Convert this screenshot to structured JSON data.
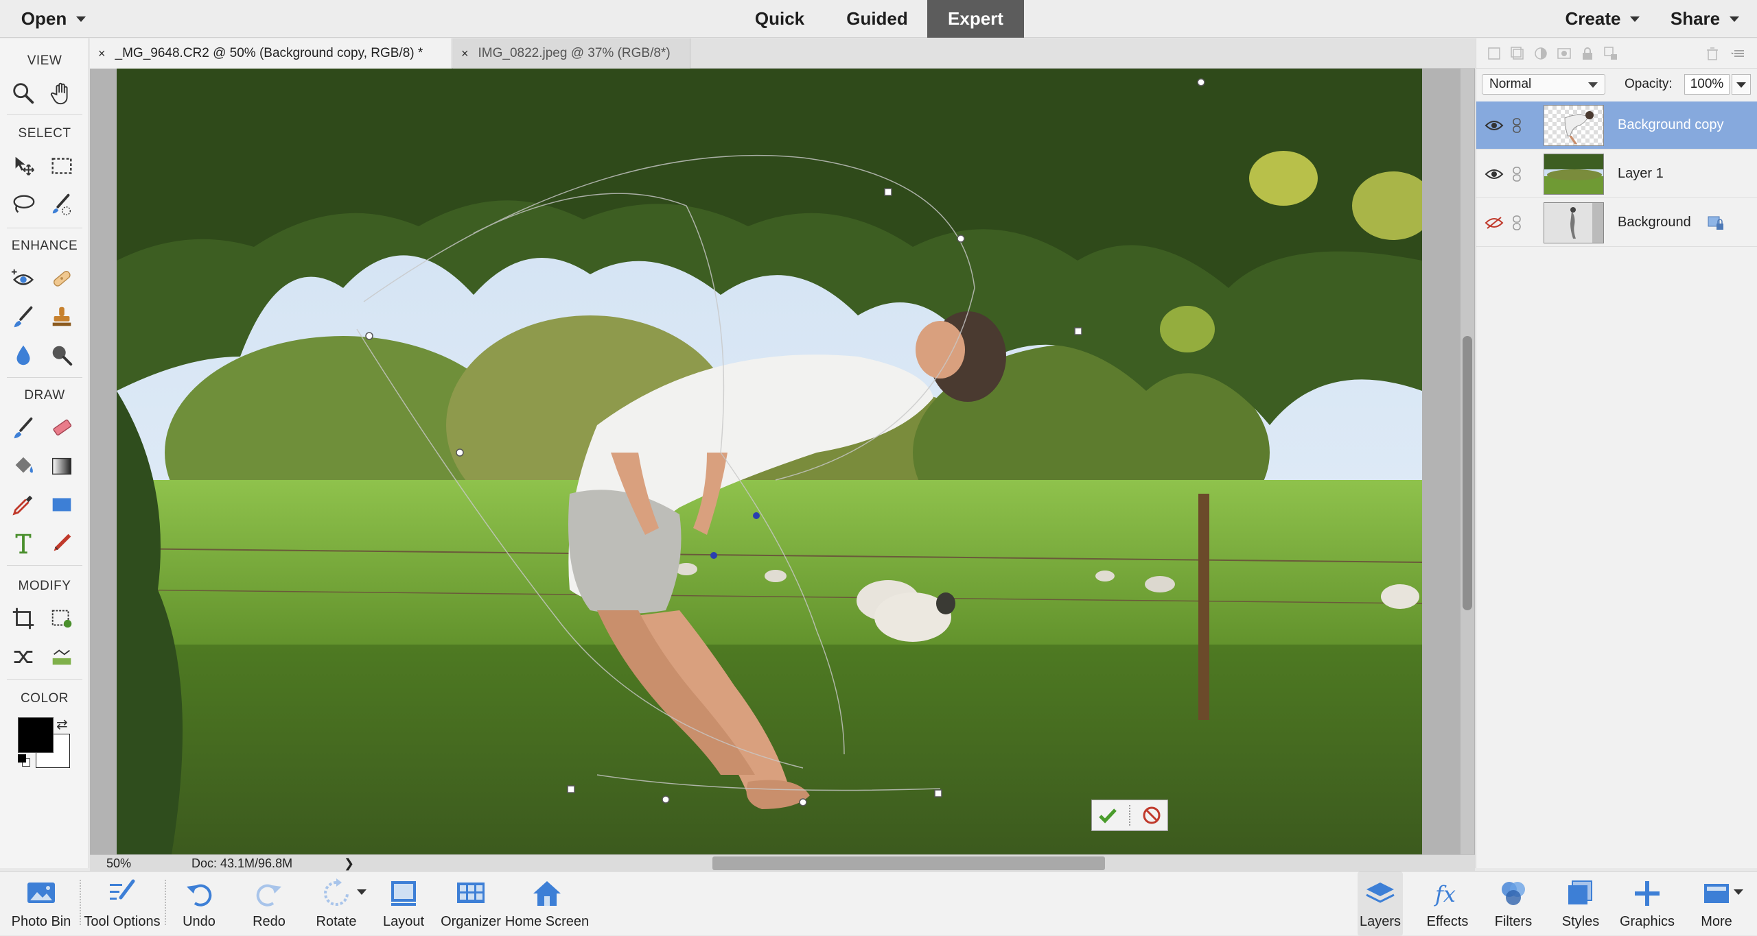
{
  "topbar": {
    "open_label": "Open",
    "modes": [
      "Quick",
      "Guided",
      "Expert"
    ],
    "active_mode": "Expert",
    "create_label": "Create",
    "share_label": "Share"
  },
  "toolbox": {
    "sections": {
      "view": "VIEW",
      "select": "SELECT",
      "enhance": "ENHANCE",
      "draw": "DRAW",
      "modify": "MODIFY",
      "color": "COLOR"
    },
    "foreground_color": "#000000",
    "background_color": "#ffffff"
  },
  "tabs": [
    {
      "close": "×",
      "label": "_MG_9648.CR2 @ 50% (Background copy, RGB/8) *"
    },
    {
      "close": "×",
      "label": "IMG_0822.jpeg @ 37% (RGB/8*)"
    }
  ],
  "status": {
    "zoom": "50%",
    "doc": "Doc: 43.1M/96.8M",
    "arrow": "❯"
  },
  "layers_panel": {
    "blend_mode": "Normal",
    "opacity_label": "Opacity:",
    "opacity_value": "100%",
    "layers": [
      {
        "name": "Background copy",
        "visible": true,
        "selected": true
      },
      {
        "name": "Layer 1",
        "visible": true,
        "selected": false
      },
      {
        "name": "Background",
        "visible": false,
        "selected": false
      }
    ]
  },
  "bottombar": {
    "photo_bin": "Photo Bin",
    "tool_options": "Tool Options",
    "undo": "Undo",
    "redo": "Redo",
    "rotate": "Rotate",
    "layout": "Layout",
    "organizer": "Organizer",
    "home_screen": "Home Screen",
    "layers": "Layers",
    "effects": "Effects",
    "filters": "Filters",
    "styles": "Styles",
    "graphics": "Graphics",
    "more": "More"
  },
  "colors": {
    "accent": "#3d7fd6",
    "selection": "#86a9dd",
    "mode_active": "#5c5c5c"
  }
}
